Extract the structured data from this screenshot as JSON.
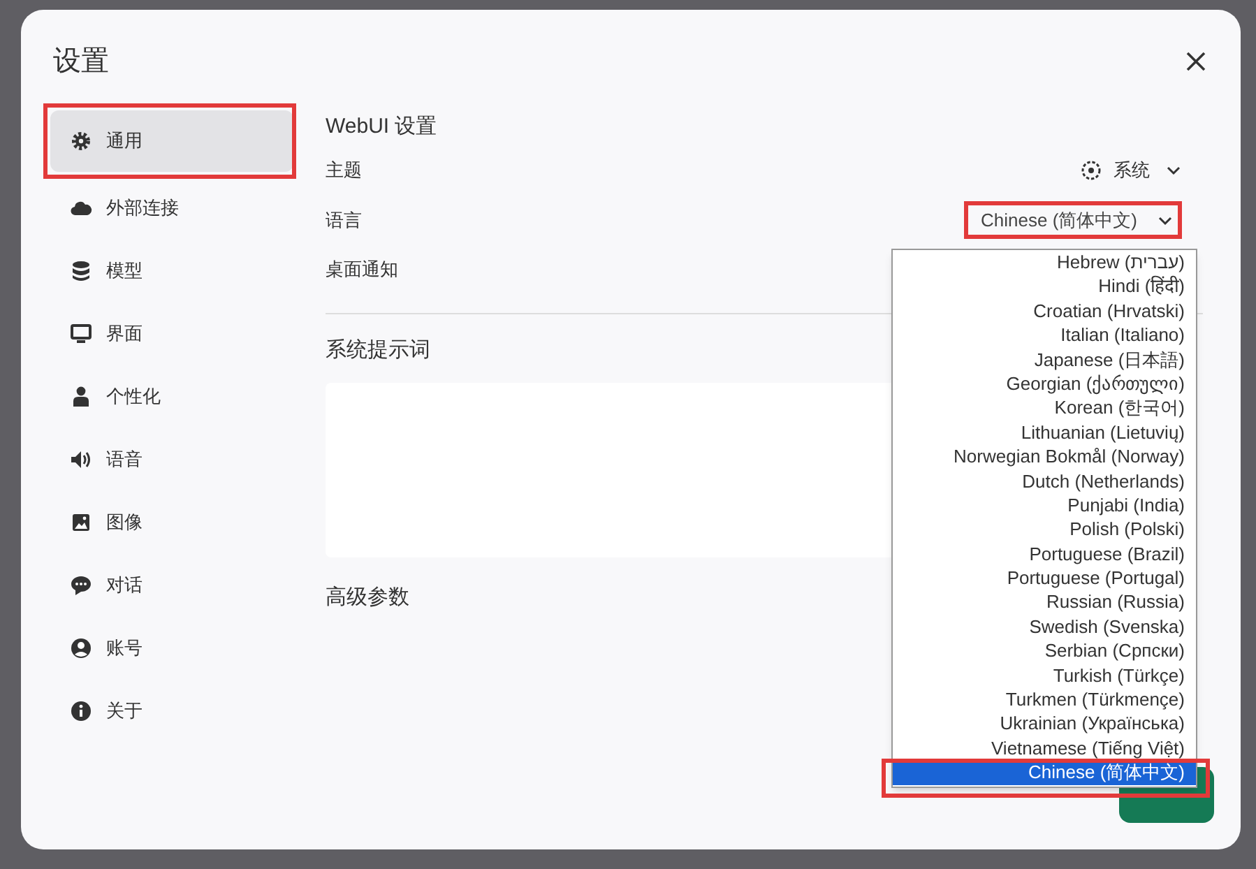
{
  "dialog": {
    "title": "设置"
  },
  "sidebar": {
    "items": [
      {
        "label": "通用",
        "selected": true,
        "highlighted": true
      },
      {
        "label": "外部连接",
        "selected": false,
        "highlighted": false
      },
      {
        "label": "模型",
        "selected": false,
        "highlighted": false
      },
      {
        "label": "界面",
        "selected": false,
        "highlighted": false
      },
      {
        "label": "个性化",
        "selected": false,
        "highlighted": false
      },
      {
        "label": "语音",
        "selected": false,
        "highlighted": false
      },
      {
        "label": "图像",
        "selected": false,
        "highlighted": false
      },
      {
        "label": "对话",
        "selected": false,
        "highlighted": false
      },
      {
        "label": "账号",
        "selected": false,
        "highlighted": false
      },
      {
        "label": "关于",
        "selected": false,
        "highlighted": false
      }
    ]
  },
  "general": {
    "heading": "WebUI 设置",
    "theme": {
      "label": "主题",
      "value": "系统"
    },
    "language": {
      "label": "语言",
      "value": "Chinese (简体中文)",
      "highlighted": true,
      "expanded": true,
      "options": [
        {
          "label": "Hebrew (עברית)",
          "selected": false,
          "highlighted": false
        },
        {
          "label": "Hindi (हिंदी)",
          "selected": false,
          "highlighted": false
        },
        {
          "label": "Croatian (Hrvatski)",
          "selected": false,
          "highlighted": false
        },
        {
          "label": "Italian (Italiano)",
          "selected": false,
          "highlighted": false
        },
        {
          "label": "Japanese (日本語)",
          "selected": false,
          "highlighted": false
        },
        {
          "label": "Georgian (ქართული)",
          "selected": false,
          "highlighted": false
        },
        {
          "label": "Korean (한국어)",
          "selected": false,
          "highlighted": false
        },
        {
          "label": "Lithuanian (Lietuvių)",
          "selected": false,
          "highlighted": false
        },
        {
          "label": "Norwegian Bokmål (Norway)",
          "selected": false,
          "highlighted": false
        },
        {
          "label": "Dutch (Netherlands)",
          "selected": false,
          "highlighted": false
        },
        {
          "label": "Punjabi (India)",
          "selected": false,
          "highlighted": false
        },
        {
          "label": "Polish (Polski)",
          "selected": false,
          "highlighted": false
        },
        {
          "label": "Portuguese (Brazil)",
          "selected": false,
          "highlighted": false
        },
        {
          "label": "Portuguese (Portugal)",
          "selected": false,
          "highlighted": false
        },
        {
          "label": "Russian (Russia)",
          "selected": false,
          "highlighted": false
        },
        {
          "label": "Swedish (Svenska)",
          "selected": false,
          "highlighted": false
        },
        {
          "label": "Serbian (Српски)",
          "selected": false,
          "highlighted": false
        },
        {
          "label": "Turkish (Türkçe)",
          "selected": false,
          "highlighted": false
        },
        {
          "label": "Turkmen (Türkmençe)",
          "selected": false,
          "highlighted": false
        },
        {
          "label": "Ukrainian (Українська)",
          "selected": false,
          "highlighted": false
        },
        {
          "label": "Vietnamese (Tiếng Việt)",
          "selected": false,
          "highlighted": false
        },
        {
          "label": "Chinese (简体中文)",
          "selected": true,
          "highlighted": true
        }
      ]
    },
    "notifications": {
      "label": "桌面通知"
    }
  },
  "system_prompt": {
    "heading": "系统提示词"
  },
  "advanced": {
    "heading": "高级参数"
  }
}
